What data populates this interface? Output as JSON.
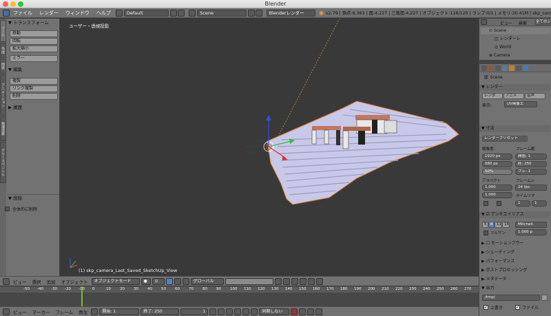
{
  "window": {
    "title": "Blender"
  },
  "menubar": {
    "items": [
      "ファイル",
      "レンダー",
      "ウィンドウ",
      "ヘルプ"
    ],
    "layout": "Default",
    "scene": "Scene",
    "engine": "Blenderレンダー",
    "stats": "v2.79 | 頂点:6,363 | 面:4,227 | 三角面:4,227 | オブジェクト:118/120 | ランプ:0/1 | メモリ:20.41M | skp_cam"
  },
  "toolshelf": {
    "tabs": [
      "ツール",
      "作成",
      "関係",
      "アニメーション",
      "物理演算",
      "グリースペンシル"
    ],
    "transform_header": "トランスフォーム",
    "transform_buttons": [
      "移動",
      "回転",
      "拡大縮小"
    ],
    "mirror_button": "ミラー",
    "edit_header": "編集",
    "edit_buttons": [
      "複製",
      "リンク複製",
      "削除"
    ],
    "history_header": "履歴",
    "delete_header": "削除",
    "delete_all_label": "全体的に削除"
  },
  "viewport": {
    "view_label": "ユーザー・透視投影",
    "object_label": "(1) skp_camera_Last_Saved_SketchUp_View"
  },
  "outliner": {
    "header_view": "ビュー",
    "header_search": "検索",
    "header_scenes": "全てのシ",
    "items": [
      "Scene",
      "レンダーレ",
      "World",
      "Camera"
    ]
  },
  "properties": {
    "scene_label": "Scene",
    "render_header": "レンダー",
    "render_buttons": [
      "レンダ",
      "アニメ",
      "音声"
    ],
    "display_label": "表示:",
    "display_value": "UV画像エ",
    "dimensions_header": "寸法",
    "preset": "レンダープリセット",
    "resolution_label": "解像度:",
    "res_x": "1920 px",
    "res_y": "080 px",
    "res_pct": "50%",
    "frame_range_label": "フレーム範",
    "frame_start": "開始: 1",
    "frame_end": "終: 250",
    "frame_step": "フレ: 1",
    "aspect_label": "アスペクト",
    "aspect_x": "1.000",
    "aspect_y": "1.000",
    "framerate_label": "フレームレ",
    "fps": "24 fps",
    "timemap_label": "タイムリマ",
    "timemap_a": "1",
    "timemap_b": "1",
    "aa_header": "アンチエイリアス",
    "aa_samples": [
      "5",
      "8",
      "11",
      "16"
    ],
    "aa_filter": "Mitchell-",
    "full_sample": "フルサン",
    "filter_size": "1.000 p",
    "motion_blur": "モーションブラー",
    "shading": "シェーディング",
    "performance": "パフォーマンス",
    "postprocessing": "ポストプロセッシング",
    "metadata": "メタデータ",
    "output": "出力",
    "output_path": "/tmp/",
    "overwrite": "上書き",
    "file_ext": "ファイル"
  },
  "viewport_header": {
    "view": "ビュー",
    "select": "選択",
    "add": "追加",
    "object": "オブジェクト",
    "mode": "オブジェクトモード",
    "orientation": "グローバル"
  },
  "timeline": {
    "ticks": [
      "-50",
      "-40",
      "-30",
      "-20",
      "-10",
      "0",
      "10",
      "20",
      "30",
      "40",
      "50",
      "60",
      "70",
      "80",
      "90",
      "100",
      "110",
      "120",
      "130",
      "140",
      "150",
      "160",
      "170",
      "180",
      "190",
      "200",
      "210",
      "220",
      "230",
      "240",
      "250",
      "260",
      "270",
      "280"
    ],
    "current_frame": 1
  },
  "timeline_header": {
    "view": "ビュー",
    "marker": "マーカー",
    "frame": "フレーム",
    "playback": "再生",
    "start": "開始:",
    "start_val": "1",
    "end": "終了:",
    "end_val": "250",
    "current": "1",
    "sync": "同期しない"
  },
  "colors": {
    "accent": "#e07820",
    "panel": "#727272",
    "viewport": "#393939"
  }
}
